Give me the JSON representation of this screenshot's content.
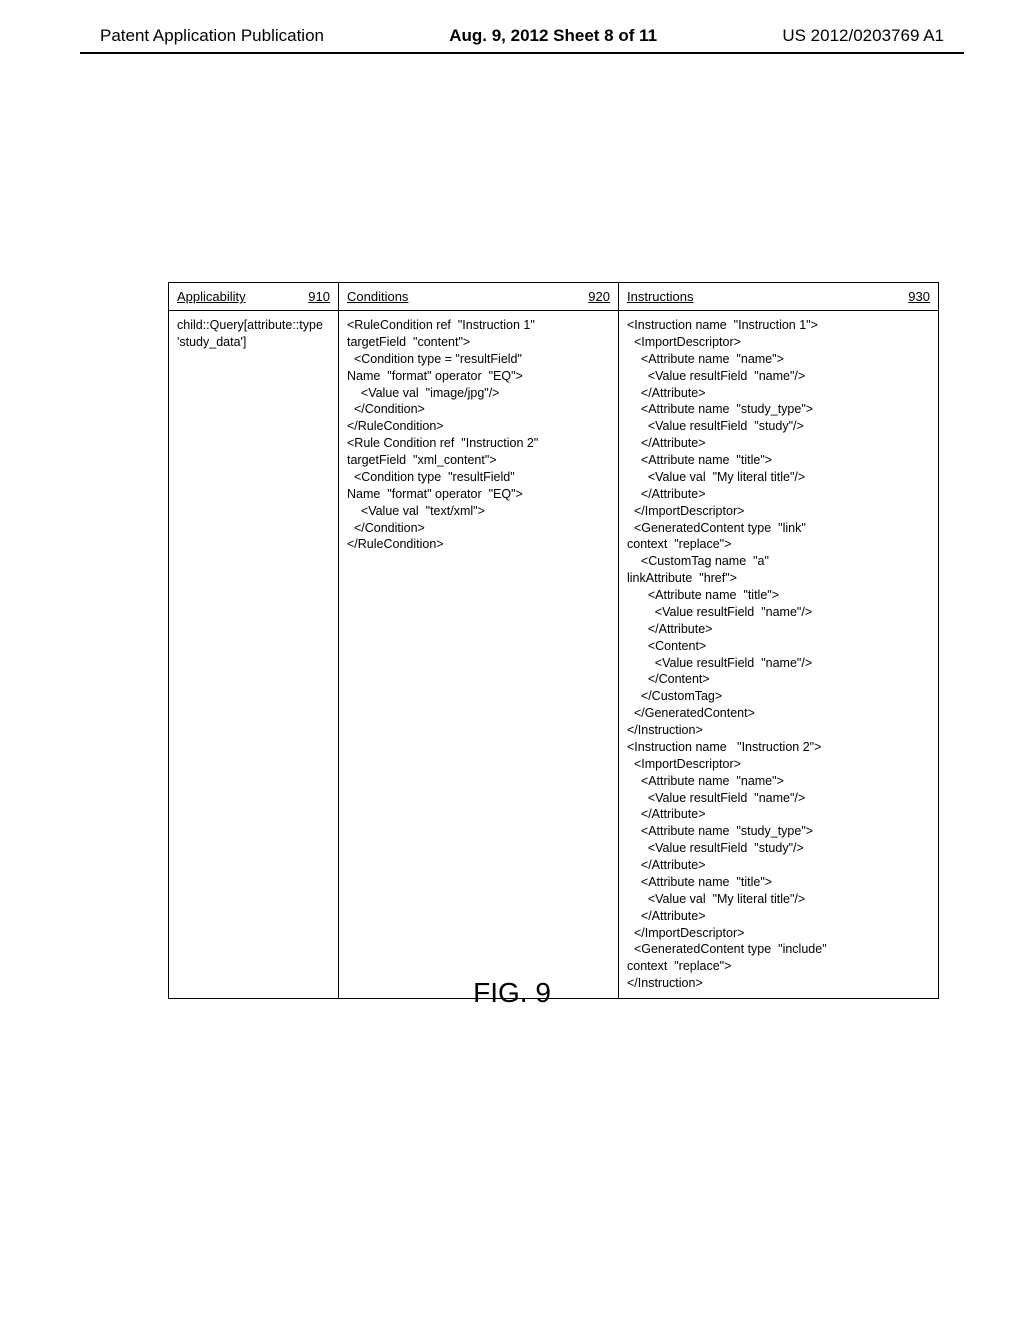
{
  "header": {
    "left": "Patent Application Publication",
    "center": "Aug. 9, 2012  Sheet 8 of 11",
    "right": "US 2012/0203769 A1"
  },
  "caption": "FIG. 9",
  "table": {
    "columns": [
      {
        "label": "Applicability",
        "num": "910"
      },
      {
        "label": "Conditions",
        "num": "920"
      },
      {
        "label": "Instructions",
        "num": "930"
      }
    ],
    "rows": [
      {
        "applicability": "child::Query[attribute::type\n'study_data']",
        "conditions": "<RuleCondition ref  \"Instruction 1\"\ntargetField  \"content\">\n  <Condition type = \"resultField\"\nName  \"format\" operator  \"EQ\">\n    <Value val  \"image/jpg\"/>\n  </Condition>\n</RuleCondition>\n<Rule Condition ref  \"Instruction 2\"\ntargetField  \"xml_content\">\n  <Condition type  \"resultField\"\nName  \"format\" operator  \"EQ\">\n    <Value val  \"text/xml\">\n  </Condition>\n</RuleCondition>",
        "instructions": "<Instruction name  \"Instruction 1\">\n  <ImportDescriptor>\n    <Attribute name  \"name\">\n      <Value resultField  \"name\"/>\n    </Attribute>\n    <Attribute name  \"study_type\">\n      <Value resultField  \"study\"/>\n    </Attribute>\n    <Attribute name  \"title\">\n      <Value val  \"My literal title\"/>\n    </Attribute>\n  </ImportDescriptor>\n  <GeneratedContent type  \"link\"\ncontext  \"replace\">\n    <CustomTag name  \"a\"\nlinkAttribute  \"href\">\n      <Attribute name  \"title\">\n        <Value resultField  \"name\"/>\n      </Attribute>\n      <Content>\n        <Value resultField  \"name\"/>\n      </Content>\n    </CustomTag>\n  </GeneratedContent>\n</Instruction>\n<Instruction name   \"Instruction 2\">\n  <ImportDescriptor>\n    <Attribute name  \"name\">\n      <Value resultField  \"name\"/>\n    </Attribute>\n    <Attribute name  \"study_type\">\n      <Value resultField  \"study\"/>\n    </Attribute>\n    <Attribute name  \"title\">\n      <Value val  \"My literal title\"/>\n    </Attribute>\n  </ImportDescriptor>\n  <GeneratedContent type  \"include\"\ncontext  \"replace\">\n</Instruction>"
      }
    ]
  }
}
